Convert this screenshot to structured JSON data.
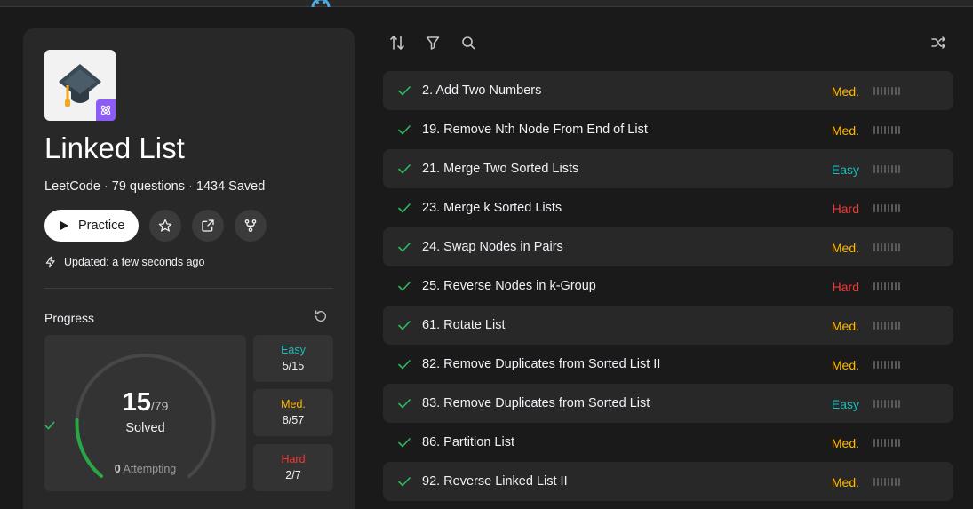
{
  "colors": {
    "easy": "#1cbaba",
    "medium": "#ffb700",
    "hard": "#f63737",
    "check": "#2cbb5d",
    "accent_ring": "#28a745"
  },
  "list_header": {
    "title": "Linked List",
    "meta": "LeetCode · 79 questions · 1434 Saved",
    "practice_label": "Practice",
    "updated": "Updated: a few seconds ago"
  },
  "progress": {
    "label": "Progress",
    "solved": "15",
    "total": "/79",
    "solved_label": "Solved",
    "solved_fraction": 0.19,
    "attempting_count": "0",
    "attempting_label": " Attempting",
    "breakdown": [
      {
        "name": "Easy",
        "value": "5/15",
        "color": "#1cbaba"
      },
      {
        "name": "Med.",
        "value": "8/57",
        "color": "#ffb700"
      },
      {
        "name": "Hard",
        "value": "2/7",
        "color": "#f63737"
      }
    ]
  },
  "toolbar": {
    "sort_icon": "sort-icon",
    "filter_icon": "filter-icon",
    "search_icon": "search-icon",
    "shuffle_icon": "shuffle-icon"
  },
  "questions": [
    {
      "title": "2. Add Two Numbers",
      "difficulty": "Med.",
      "color": "#ffb700"
    },
    {
      "title": "19. Remove Nth Node From End of List",
      "difficulty": "Med.",
      "color": "#ffb700"
    },
    {
      "title": "21. Merge Two Sorted Lists",
      "difficulty": "Easy",
      "color": "#1cbaba"
    },
    {
      "title": "23. Merge k Sorted Lists",
      "difficulty": "Hard",
      "color": "#f63737"
    },
    {
      "title": "24. Swap Nodes in Pairs",
      "difficulty": "Med.",
      "color": "#ffb700"
    },
    {
      "title": "25. Reverse Nodes in k-Group",
      "difficulty": "Hard",
      "color": "#f63737"
    },
    {
      "title": "61. Rotate List",
      "difficulty": "Med.",
      "color": "#ffb700"
    },
    {
      "title": "82. Remove Duplicates from Sorted List II",
      "difficulty": "Med.",
      "color": "#ffb700"
    },
    {
      "title": "83. Remove Duplicates from Sorted List",
      "difficulty": "Easy",
      "color": "#1cbaba"
    },
    {
      "title": "86. Partition List",
      "difficulty": "Med.",
      "color": "#ffb700"
    },
    {
      "title": "92. Reverse Linked List II",
      "difficulty": "Med.",
      "color": "#ffb700"
    }
  ]
}
